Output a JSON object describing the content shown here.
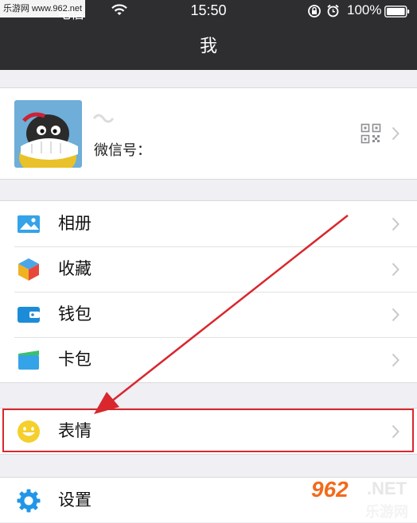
{
  "status_bar": {
    "watermark": "乐游网 www.962.net",
    "carrier": "电信",
    "time": "15:50",
    "battery": "100%"
  },
  "nav": {
    "title": "我"
  },
  "profile": {
    "wechat_id_label": "微信号："
  },
  "menu_group_1": [
    {
      "label": "相册",
      "icon": "photo-album-icon"
    },
    {
      "label": "收藏",
      "icon": "favorites-cube-icon"
    },
    {
      "label": "钱包",
      "icon": "wallet-icon"
    },
    {
      "label": "卡包",
      "icon": "card-pack-icon"
    }
  ],
  "menu_group_2": [
    {
      "label": "表情",
      "icon": "smiley-icon"
    }
  ],
  "menu_group_3": [
    {
      "label": "设置",
      "icon": "gear-icon"
    }
  ],
  "watermark_bottom": {
    "brand": "962",
    "suffix": ".NET",
    "site": "乐游网"
  },
  "colors": {
    "nav_bg": "#2e2e31",
    "highlight": "#d9272e",
    "accent": "#1aad19"
  }
}
